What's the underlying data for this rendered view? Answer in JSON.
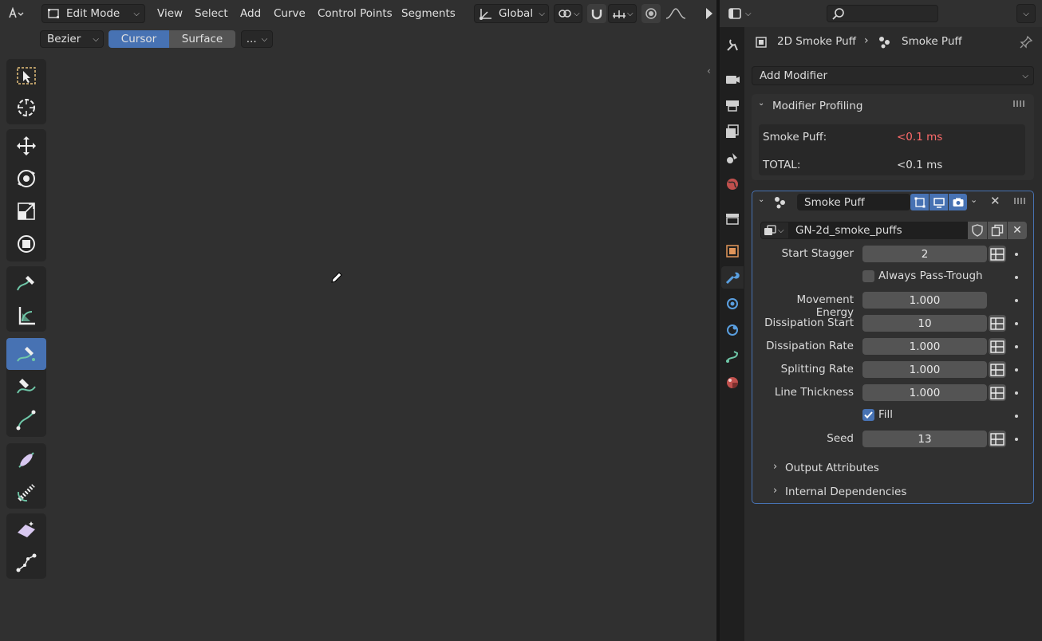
{
  "viewport": {
    "mode_label": "Edit Mode",
    "menus": [
      "View",
      "Select",
      "Add",
      "Curve",
      "Control Points",
      "Segments"
    ],
    "orientation_label": "Global",
    "curve_type_label": "Bezier",
    "placement_options": [
      "Cursor",
      "Surface"
    ],
    "placement_selected": "Cursor",
    "more_label": "...",
    "tools": [
      {
        "name": "select-box-tool",
        "icon": "select-box-icon"
      },
      {
        "name": "cursor-tool",
        "icon": "cursor-icon"
      },
      {
        "name": "move-tool",
        "icon": "move-icon"
      },
      {
        "name": "rotate-tool",
        "icon": "rotate-icon"
      },
      {
        "name": "scale-tool",
        "icon": "scale-icon"
      },
      {
        "name": "transform-tool",
        "icon": "transform-icon"
      },
      {
        "name": "annotate-tool",
        "icon": "annotate-icon"
      },
      {
        "name": "measure-tool",
        "icon": "measure-icon"
      },
      {
        "name": "draw-tool",
        "icon": "draw-curve-icon",
        "active": true
      },
      {
        "name": "pen-tool",
        "icon": "pen-icon"
      },
      {
        "name": "extrude-tool",
        "icon": "extrude-icon"
      },
      {
        "name": "radius-tool",
        "icon": "radius-icon"
      },
      {
        "name": "tilt-tool",
        "icon": "tilt-icon"
      },
      {
        "name": "randomize-tool",
        "icon": "randomize-icon"
      },
      {
        "name": "curve-vertex-tool",
        "icon": "curve-vertex-icon"
      }
    ]
  },
  "properties": {
    "search_placeholder": "",
    "breadcrumb": {
      "object": "2D Smoke Puff",
      "modifier": "Smoke Puff"
    },
    "add_modifier_label": "Add Modifier",
    "profiling": {
      "title": "Modifier Profiling",
      "rows": [
        {
          "label": "Smoke Puff:",
          "value": "<0.1 ms",
          "warn": true
        },
        {
          "label": "TOTAL:",
          "value": "<0.1 ms",
          "warn": false
        }
      ]
    },
    "modifier": {
      "name": "Smoke Puff",
      "node_group": "GN-2d_smoke_puffs",
      "inputs": [
        {
          "label": "Start Stagger",
          "value": "2",
          "type": "field",
          "socket": true
        },
        {
          "label": "Always Pass-Trough",
          "value": "",
          "type": "checkbox",
          "checked": false
        },
        {
          "label": "Movement Energy",
          "value": "1.000",
          "type": "field",
          "socket": false
        },
        {
          "label": "Dissipation Start",
          "value": "10",
          "type": "field",
          "socket": true
        },
        {
          "label": "Dissipation Rate",
          "value": "1.000",
          "type": "field",
          "socket": true
        },
        {
          "label": "Splitting Rate",
          "value": "1.000",
          "type": "field",
          "socket": true
        },
        {
          "label": "Line Thickness",
          "value": "1.000",
          "type": "field",
          "socket": true
        },
        {
          "label": "Fill",
          "value": "",
          "type": "checkbox",
          "checked": true
        },
        {
          "label": "Seed",
          "value": "13",
          "type": "field",
          "socket": true
        }
      ],
      "subpanels": [
        "Output Attributes",
        "Internal Dependencies"
      ]
    },
    "colors": {
      "accent": "#4772b3",
      "warn": "#ff6b6b",
      "panel_border": "#4772b3"
    }
  }
}
